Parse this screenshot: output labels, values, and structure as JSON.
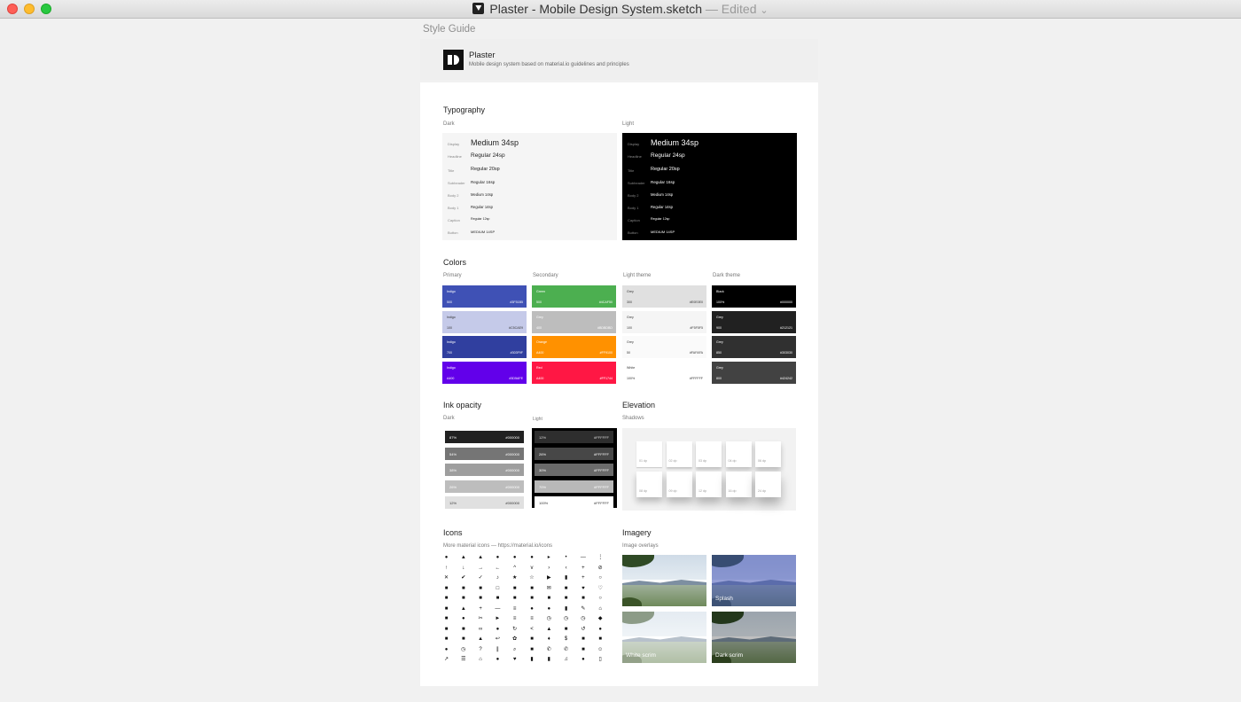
{
  "window": {
    "title": "Plaster - Mobile Design System.sketch",
    "status": "— Edited",
    "chevron": "⌄"
  },
  "page_label": "Style Guide",
  "header": {
    "title": "Plaster",
    "subtitle": "Mobile design system based on material.io guidelines and principles"
  },
  "typography": {
    "title": "Typography",
    "dark_label": "Dark",
    "light_label": "Light",
    "rows": [
      {
        "name": "Display",
        "sample": "Medium 34sp"
      },
      {
        "name": "Headline",
        "sample": "Regular 24sp"
      },
      {
        "name": "Title",
        "sample": "Regular 20sp"
      },
      {
        "name": "Subheader",
        "sample": "Regular 16sp"
      },
      {
        "name": "Body 2",
        "sample": "Medium 14sp"
      },
      {
        "name": "Body 1",
        "sample": "Regular 14sp"
      },
      {
        "name": "Caption",
        "sample": "Regular 12sp"
      },
      {
        "name": "Button",
        "sample": "MEDIUM 14SP"
      }
    ]
  },
  "colors": {
    "title": "Colors",
    "groups": [
      {
        "label": "Primary",
        "swatches": [
          {
            "name": "Indigo",
            "shade": "500",
            "hex": "#3F51B5",
            "bg": "#3F51B5",
            "fg": "#ffffff"
          },
          {
            "name": "Indigo",
            "shade": "100",
            "hex": "#C5CAE9",
            "bg": "#C5CAE9",
            "fg": "#333333"
          },
          {
            "name": "Indigo",
            "shade": "700",
            "hex": "#303F9F",
            "bg": "#303F9F",
            "fg": "#ffffff"
          },
          {
            "name": "Indigo",
            "shade": "A400",
            "hex": "#3D5AFE",
            "bg": "#6200EA",
            "fg": "#ffffff"
          }
        ]
      },
      {
        "label": "Secondary",
        "swatches": [
          {
            "name": "Green",
            "shade": "500",
            "hex": "#4CAF50",
            "bg": "#4CAF50",
            "fg": "#ffffff"
          },
          {
            "name": "Grey",
            "shade": "400",
            "hex": "#BDBDBD",
            "bg": "#BDBDBD",
            "fg": "#ffffff"
          },
          {
            "name": "Orange",
            "shade": "A400",
            "hex": "#FF9100",
            "bg": "#FF9100",
            "fg": "#ffffff"
          },
          {
            "name": "Red",
            "shade": "A400",
            "hex": "#FF1744",
            "bg": "#FF1744",
            "fg": "#ffffff"
          }
        ]
      },
      {
        "label": "Light theme",
        "swatches": [
          {
            "name": "Grey",
            "shade": "300",
            "hex": "#E0E0E0",
            "bg": "#E0E0E0",
            "fg": "#333333"
          },
          {
            "name": "Grey",
            "shade": "100",
            "hex": "#F5F5F5",
            "bg": "#F5F5F5",
            "fg": "#333333"
          },
          {
            "name": "Grey",
            "shade": "50",
            "hex": "#FAFAFA",
            "bg": "#FAFAFA",
            "fg": "#333333"
          },
          {
            "name": "White",
            "shade": "100%",
            "hex": "#FFFFFF",
            "bg": "#FFFFFF",
            "fg": "#333333"
          }
        ]
      },
      {
        "label": "Dark theme",
        "swatches": [
          {
            "name": "Black",
            "shade": "100%",
            "hex": "#000000",
            "bg": "#000000",
            "fg": "#ffffff"
          },
          {
            "name": "Grey",
            "shade": "900",
            "hex": "#212121",
            "bg": "#212121",
            "fg": "#ffffff"
          },
          {
            "name": "Grey",
            "shade": "850",
            "hex": "#303030",
            "bg": "#303030",
            "fg": "#ffffff"
          },
          {
            "name": "Grey",
            "shade": "800",
            "hex": "#424242",
            "bg": "#424242",
            "fg": "#ffffff"
          }
        ]
      }
    ]
  },
  "ink": {
    "title": "Ink opacity",
    "dark_label": "Dark",
    "light_label": "Light",
    "dark": [
      {
        "pct": "87%",
        "hex": "#000000",
        "bg": "#212121",
        "fg": "#ffffff"
      },
      {
        "pct": "54%",
        "hex": "#000000",
        "bg": "#757575",
        "fg": "#ffffff"
      },
      {
        "pct": "38%",
        "hex": "#000000",
        "bg": "#9e9e9e",
        "fg": "#ffffff"
      },
      {
        "pct": "26%",
        "hex": "#000000",
        "bg": "#bdbdbd",
        "fg": "#ffffff"
      },
      {
        "pct": "12%",
        "hex": "#000000",
        "bg": "#e0e0e0",
        "fg": "#333333"
      }
    ],
    "light": [
      {
        "pct": "12%",
        "hex": "#FFFFFF",
        "bg": "#2e2e2e",
        "fg": "#dddddd"
      },
      {
        "pct": "26%",
        "hex": "#FFFFFF",
        "bg": "#474747",
        "fg": "#ffffff"
      },
      {
        "pct": "30%",
        "hex": "#FFFFFF",
        "bg": "#6a6a6a",
        "fg": "#ffffff"
      },
      {
        "pct": "70%",
        "hex": "#FFFFFF",
        "bg": "#b8b8b8",
        "fg": "#ffffff"
      },
      {
        "pct": "100%",
        "hex": "#FFFFFF",
        "bg": "#ffffff",
        "fg": "#333333"
      }
    ]
  },
  "elevation": {
    "title": "Elevation",
    "label": "Shadows",
    "cards": [
      "01 dp",
      "02 dp",
      "03 dp",
      "04 dp",
      "06 dp",
      "08 dp",
      "09 dp",
      "12 dp",
      "16 dp",
      "24 dp"
    ]
  },
  "icons": {
    "title": "Icons",
    "subtitle": "More material icons — https://material.io/icons",
    "glyphs": [
      "●",
      "▲",
      "▲",
      "●",
      "●",
      "●",
      "▸",
      "•",
      "—",
      "⋮",
      "↑",
      "↓",
      "→",
      "←",
      "^",
      "v",
      "›",
      "‹",
      "+",
      "⊘",
      "✕",
      "✔",
      "✓",
      "♪",
      "★",
      "☆",
      "▶",
      "▮",
      "+",
      "○",
      "■",
      "■",
      "■",
      "□",
      "■",
      "■",
      "✉",
      "■",
      "♥",
      "♡",
      "■",
      "■",
      "■",
      "■",
      "■",
      "■",
      "■",
      "■",
      "■",
      "○",
      "■",
      "▲",
      "+",
      "—",
      "≡",
      "●",
      "●",
      "▮",
      "✎",
      "⌂",
      "■",
      "●",
      "✂",
      "►",
      "≡",
      "≡",
      "◷",
      "◷",
      "◷",
      "◆",
      "■",
      "■",
      "∞",
      "●",
      "↻",
      "<",
      "▲",
      "■",
      "↺",
      "●",
      "■",
      "■",
      "▲",
      "↩",
      "✿",
      "■",
      "♦",
      "$",
      "■",
      "■",
      "●",
      "◷",
      "?",
      "∥",
      "⌕",
      "■",
      "✆",
      "✆",
      "■",
      "☺",
      "↗",
      "☰",
      "⌂",
      "●",
      "♥",
      "▮",
      "▮",
      "♫",
      "●",
      "▯"
    ]
  },
  "imagery": {
    "title": "Imagery",
    "label": "Image overlays",
    "images": [
      {
        "caption": "",
        "overlay": "rgba(0,0,0,0)"
      },
      {
        "caption": "Splash",
        "overlay": "rgba(63,81,181,0.55)"
      },
      {
        "caption": "White scrim",
        "overlay": "rgba(255,255,255,0.45)"
      },
      {
        "caption": "Dark scrim",
        "overlay": "rgba(0,0,0,0.25)"
      }
    ]
  }
}
